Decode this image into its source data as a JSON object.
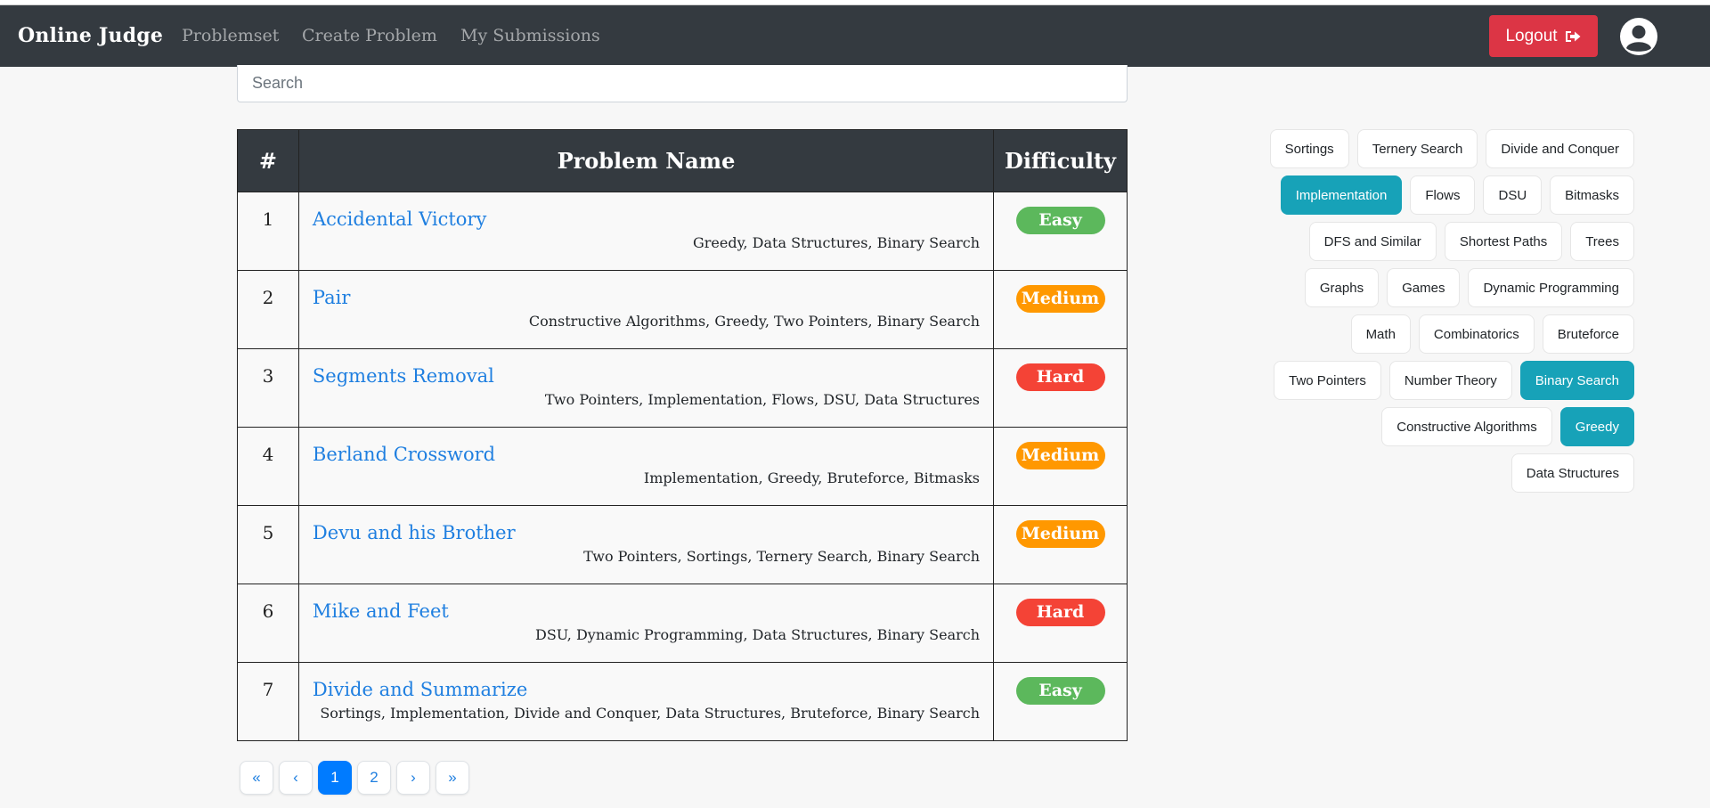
{
  "nav": {
    "brand": "Online Judge",
    "links": [
      "Problemset",
      "Create Problem",
      "My Submissions"
    ],
    "logout_label": "Logout"
  },
  "search": {
    "placeholder": "Search"
  },
  "table": {
    "headers": [
      "#",
      "Problem Name",
      "Difficulty"
    ],
    "rows": [
      {
        "num": "1",
        "name": "Accidental Victory",
        "tags": "Greedy, Data Structures, Binary Search",
        "difficulty": "Easy"
      },
      {
        "num": "2",
        "name": "Pair",
        "tags": "Constructive Algorithms, Greedy, Two Pointers, Binary Search",
        "difficulty": "Medium"
      },
      {
        "num": "3",
        "name": "Segments Removal",
        "tags": "Two Pointers, Implementation, Flows, DSU, Data Structures",
        "difficulty": "Hard"
      },
      {
        "num": "4",
        "name": "Berland Crossword",
        "tags": "Implementation, Greedy, Bruteforce, Bitmasks",
        "difficulty": "Medium"
      },
      {
        "num": "5",
        "name": "Devu and his Brother",
        "tags": "Two Pointers, Sortings, Ternery Search, Binary Search",
        "difficulty": "Medium"
      },
      {
        "num": "6",
        "name": "Mike and Feet",
        "tags": "DSU, Dynamic Programming, Data Structures, Binary Search",
        "difficulty": "Hard"
      },
      {
        "num": "7",
        "name": "Divide and Summarize",
        "tags": "Sortings, Implementation, Divide and Conquer, Data Structures, Bruteforce, Binary Search",
        "difficulty": "Easy"
      }
    ]
  },
  "difficulty_colors": {
    "Easy": "#5cb85c",
    "Medium": "#ff9800",
    "Hard": "#f44336"
  },
  "pagination": [
    "«",
    "‹",
    "1",
    "2",
    "›",
    "»"
  ],
  "pagination_active": "1",
  "tag_filter": [
    {
      "label": "Sortings",
      "selected": false
    },
    {
      "label": "Ternery Search",
      "selected": false
    },
    {
      "label": "Divide and Conquer",
      "selected": false
    },
    {
      "label": "Implementation",
      "selected": true
    },
    {
      "label": "Flows",
      "selected": false
    },
    {
      "label": "DSU",
      "selected": false
    },
    {
      "label": "Bitmasks",
      "selected": false
    },
    {
      "label": "DFS and Similar",
      "selected": false
    },
    {
      "label": "Shortest Paths",
      "selected": false
    },
    {
      "label": "Trees",
      "selected": false
    },
    {
      "label": "Graphs",
      "selected": false
    },
    {
      "label": "Games",
      "selected": false
    },
    {
      "label": "Dynamic Programming",
      "selected": false
    },
    {
      "label": "Math",
      "selected": false
    },
    {
      "label": "Combinatorics",
      "selected": false
    },
    {
      "label": "Bruteforce",
      "selected": false
    },
    {
      "label": "Two Pointers",
      "selected": false
    },
    {
      "label": "Number Theory",
      "selected": false
    },
    {
      "label": "Binary Search",
      "selected": true
    },
    {
      "label": "Constructive Algorithms",
      "selected": false
    },
    {
      "label": "Greedy",
      "selected": true
    },
    {
      "label": "Data Structures",
      "selected": false
    }
  ],
  "icons": {
    "logout": "sign-out-icon",
    "avatar": "user-circle-icon"
  }
}
